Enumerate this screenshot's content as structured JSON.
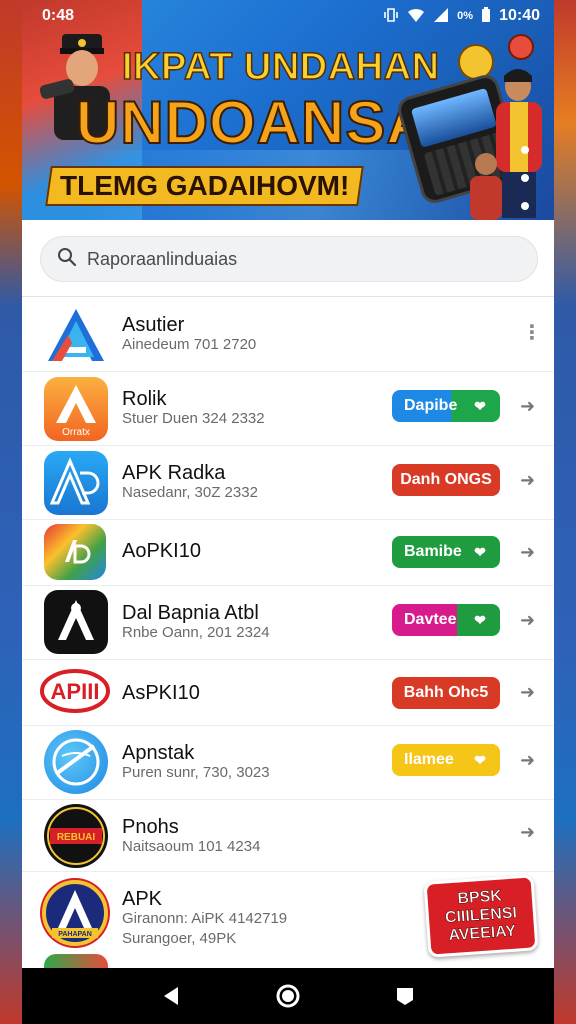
{
  "status_bar": {
    "time": "0:48",
    "battery": "0%",
    "clock_right": "10:40"
  },
  "banner": {
    "title": "IKPAT UNDAHAN",
    "headline": "UNDOANSA",
    "ribbon": "TLEMG GADAIHOVM!"
  },
  "search": {
    "placeholder": "Raporaanlinduaias"
  },
  "apps": [
    {
      "name": "Asutier",
      "subtitle": "Ainedeum 701 2720",
      "action": "more"
    },
    {
      "name": "Rolik",
      "icon_text": "Orratx",
      "subtitle": "Stuer Duen 324 2332",
      "button": "Dapibe",
      "button_color": "#1e88e5",
      "button_accent": "#1ea64a"
    },
    {
      "name": "APK Radka",
      "subtitle": "Nasedanr, 30Z 2332",
      "button": "Danh ONGS",
      "button_color": "#d93a26"
    },
    {
      "name": "AoPKI10",
      "subtitle": "",
      "button": "Bamibe",
      "button_color": "#1f9c40",
      "button_accent": "#1f9c40"
    },
    {
      "name": "Dal Bapnia Atbl",
      "subtitle": "Rnbe Oann, 201 2324",
      "button": "Davtee",
      "button_color": "#d81b8c",
      "button_accent": "#1f9c40"
    },
    {
      "name": "AsPKI10",
      "icon_text": "APIII",
      "subtitle": "",
      "button": "Bahh Ohc5",
      "button_color": "#d93a26"
    },
    {
      "name": "Apnstak",
      "subtitle": "Puren sunr, 730, 3023",
      "button": "Ilamee",
      "button_color": "#f5c518",
      "button_accent": "#f5c518"
    },
    {
      "name": "Pnohs",
      "icon_text": "REBUAI",
      "subtitle": "Naitsaoum 101 4234",
      "action": "arrow"
    },
    {
      "name": "APK",
      "icon_text": "PAHAPAN",
      "subtitle": "Giranonn: AiPK 4142719",
      "subtitle2": "Surangoer, 49PK",
      "promo": [
        "BPSK",
        "CIIILENSI",
        "AVEEIAY"
      ]
    }
  ],
  "colors": {
    "accent_blue": "#1e88e5",
    "accent_red": "#d93a26",
    "accent_green": "#1f9c40",
    "accent_magenta": "#d81b8c",
    "accent_yellow": "#f5c518"
  },
  "nav": {
    "icons": [
      "back-icon",
      "home-icon",
      "recents-icon"
    ]
  }
}
